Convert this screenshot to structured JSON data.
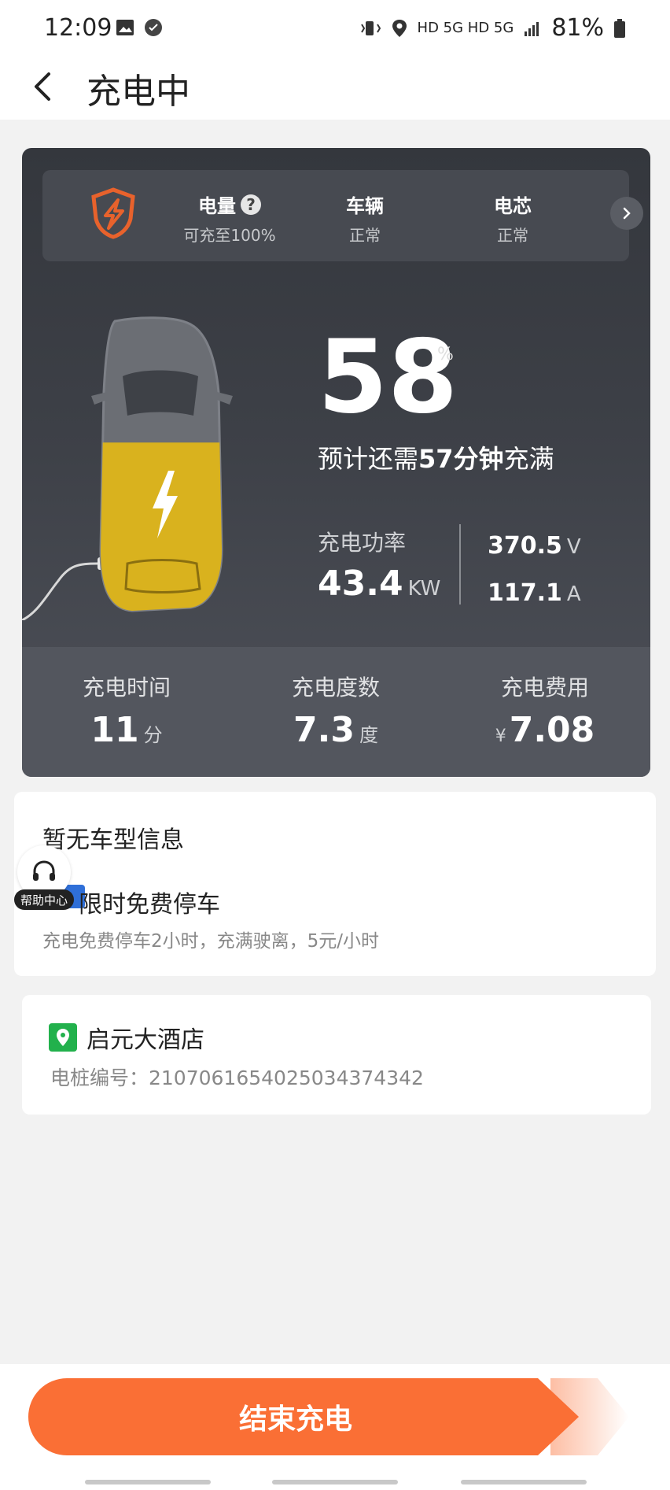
{
  "status_bar": {
    "time": "12:09",
    "network": "HD 5G HD 5G",
    "battery": "81%"
  },
  "header": {
    "title": "充电中"
  },
  "battery_check": {
    "items": [
      {
        "title": "电量",
        "sub": "可充至100%"
      },
      {
        "title": "车辆",
        "sub": "正常"
      },
      {
        "title": "电芯",
        "sub": "正常"
      }
    ]
  },
  "charging": {
    "percent": "58",
    "percent_symbol": "%",
    "remain_prefix": "预计还需",
    "remain_time": "57分钟",
    "remain_suffix": "充满",
    "power_label": "充电功率",
    "power_value": "43.4",
    "power_unit": "KW",
    "voltage_value": "370.5",
    "voltage_unit": "V",
    "current_value": "117.1",
    "current_unit": "A",
    "level_fraction": 0.58
  },
  "stats": [
    {
      "label": "充电时间",
      "value": "11",
      "unit": "分"
    },
    {
      "label": "充电度数",
      "value": "7.3",
      "unit": "度"
    },
    {
      "label": "充电费用",
      "currency": "¥",
      "value": "7.08"
    }
  ],
  "info": {
    "title": "暂无车型信息",
    "parking_title": "限时免费停车",
    "parking_desc": "充电免费停车2小时，充满驶离，5元/小时"
  },
  "help": {
    "label": "帮助中心"
  },
  "station": {
    "name": "启元大酒店",
    "number": "电桩编号：2107061654025034374342"
  },
  "actions": {
    "end_label": "结束充电"
  },
  "colors": {
    "accent": "#fa6f35",
    "card_dark": "#3d4047",
    "charge_yellow": "#d9b21e",
    "pin_green": "#22b14c"
  }
}
